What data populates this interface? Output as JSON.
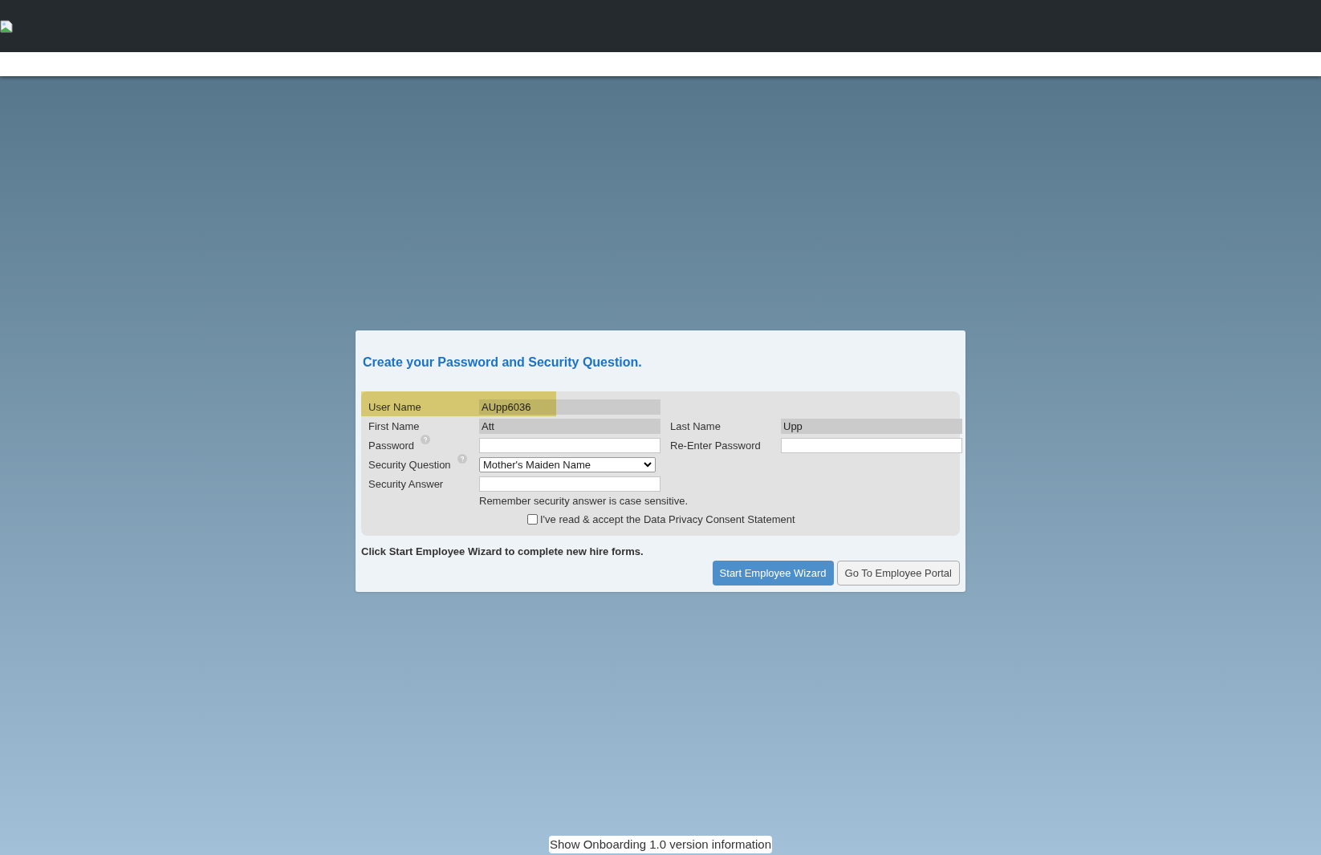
{
  "title": "Create your Password and Security Question.",
  "rows": [
    {
      "fields": [
        {
          "kind": "readonly",
          "label": "User Name",
          "value": "AUpp6036",
          "highlighted": true
        }
      ]
    },
    {
      "fields": [
        {
          "kind": "readonly",
          "label": "First Name",
          "value": "Att"
        },
        {
          "kind": "readonly",
          "label": "Last Name",
          "value": "Upp"
        }
      ]
    },
    {
      "fields": [
        {
          "kind": "input",
          "label": "Password",
          "help": true
        },
        {
          "kind": "input",
          "label": "Re-Enter Password"
        }
      ]
    },
    {
      "fields": [
        {
          "kind": "select",
          "label": "Security Question",
          "value": "Mother's Maiden Name",
          "help": true
        }
      ]
    },
    {
      "fields": [
        {
          "kind": "input",
          "label": "Security Answer",
          "hint": "Remember security answer is case sensitive."
        }
      ]
    }
  ],
  "consent": {
    "label": "I've read & accept the Data Privacy Consent Statement",
    "checked": false
  },
  "instruction": "Click Start Employee Wizard to complete new hire forms.",
  "buttons": [
    {
      "label": "Start Employee Wizard",
      "kind": "primary"
    },
    {
      "label": "Go To Employee Portal",
      "kind": "secondary"
    }
  ],
  "footer_link": "Show Onboarding 1.0 version information"
}
